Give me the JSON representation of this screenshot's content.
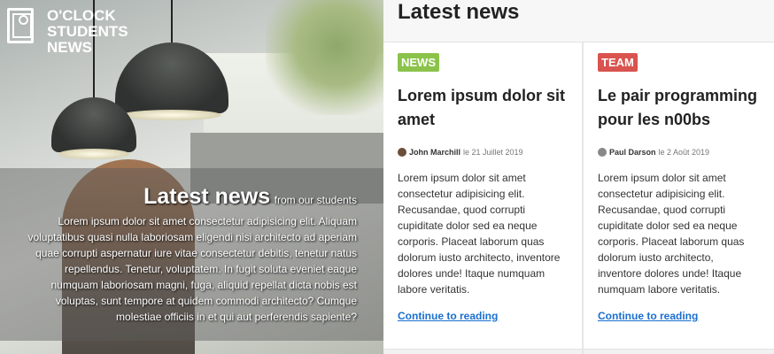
{
  "brand": {
    "name_line1": "O'CLOCK",
    "name_line2": "STUDENTS",
    "name_line3": "NEWS"
  },
  "hero": {
    "title": "Latest news",
    "subtitle": "from our students",
    "body": "Lorem ipsum dolor sit amet consectetur adipisicing elit. Aliquam voluptatibus quasi nulla laboriosam eligendi nisi architecto ad aperiam quae corrupti aspernatur iure vitae consectetur debitis, tenetur natus repellendus. Tenetur, voluptatem. In fugit soluta eveniet eaque numquam laboriosam magni, fuga, aliquid repellat dicta nobis est voluptas, sunt tempore at quidem commodi architecto? Cumque molestiae officiis in et qui aut perferendis sapiente?"
  },
  "news": {
    "heading": "Latest news",
    "articles": [
      {
        "tag": "NEWS",
        "tag_color": "#8bc34a",
        "title": "Lorem ipsum dolor sit amet",
        "author": "John Marchill",
        "date": "le 21 Juillet 2019",
        "body": "Lorem ipsum dolor sit amet consectetur adipisicing elit. Recusandae, quod corrupti cupiditate dolor sed ea neque corporis. Placeat laborum quas dolorum iusto architecto, inventore dolores unde! Itaque numquam labore veritatis.",
        "link": "Continue to reading"
      },
      {
        "tag": "TEAM",
        "tag_color": "#d9534f",
        "title": "Le pair programming pour les n00bs",
        "author": "Paul Darson",
        "date": "le 2 Août 2019",
        "body": "Lorem ipsum dolor sit amet consectetur adipisicing elit. Recusandae, quod corrupti cupiditate dolor sed ea neque corporis. Placeat laborum quas dolorum iusto architecto, inventore dolores unde! Itaque numquam labore veritatis.",
        "link": "Continue to reading"
      }
    ]
  }
}
